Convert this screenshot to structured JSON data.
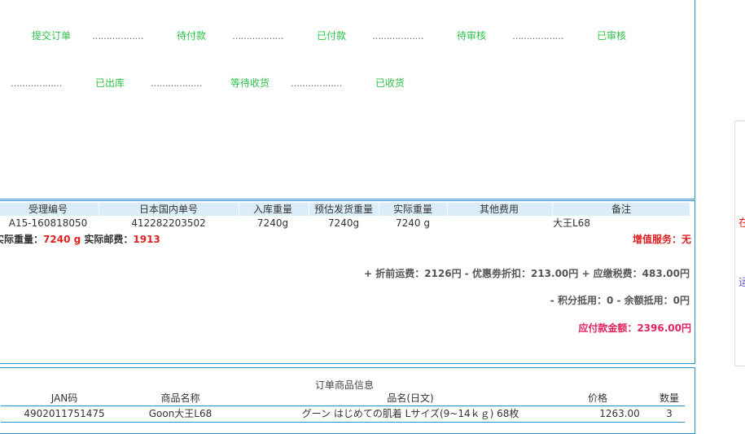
{
  "status_flow": {
    "row1": [
      {
        "label": "提交订单"
      },
      {
        "dots": "………………"
      },
      {
        "label": "待付款"
      },
      {
        "dots": "………………"
      },
      {
        "label": "已付款"
      },
      {
        "dots": "………………"
      },
      {
        "label": "待审核"
      },
      {
        "dots": "………………"
      },
      {
        "label": "已审核"
      }
    ],
    "row2": [
      {
        "dots": "………………"
      },
      {
        "label": "已出库"
      },
      {
        "dots": "………………"
      },
      {
        "label": "等待收货"
      },
      {
        "dots": "………………"
      },
      {
        "label": "已收货"
      }
    ]
  },
  "shipment": {
    "headers": [
      "受理编号",
      "日本国内单号",
      "入库重量",
      "预估发货重量",
      "实际重量",
      "其他费用",
      "备注"
    ],
    "row": [
      "A15-160818050",
      "412282203502",
      "7240g",
      "7240g",
      "7240 g",
      "",
      "大王L68"
    ],
    "actual_weight_label": "实际重量：",
    "actual_weight_value": "7240 g",
    "actual_postage_label": "实际邮费：",
    "actual_postage_value": "1913",
    "value_added_label": "增值服务：",
    "value_added_value": "无",
    "fee_line": "+ 折前运费：2126円 - 优惠劵折扣：213.00円 + 应缴税费：483.00円",
    "deduct_line": "- 积分抵用：0 - 余额抵用：0円",
    "payable_line": "应付款金额：2396.00円"
  },
  "goods": {
    "title": "订单商品信息",
    "headers": {
      "jan": "JAN码",
      "name": "商品名称",
      "jp_name": "品名(日文)",
      "price": "价格",
      "qty": "数量"
    },
    "rows": [
      {
        "jan": "4902011751475",
        "name": "Goon大王L68",
        "jp_name": "グーン はじめての肌着 Lサイズ(9~14ｋｇ) 68枚",
        "price": "1263.00",
        "qty": "3"
      }
    ]
  },
  "side": {
    "char1": "在",
    "char2": "运"
  },
  "colors": {
    "border": "#2e8fd0",
    "header_bg": "#dcedfa",
    "status_green": "#2fc24a",
    "highlight_red": "#e02020",
    "payable_pink": "#e0245e"
  }
}
